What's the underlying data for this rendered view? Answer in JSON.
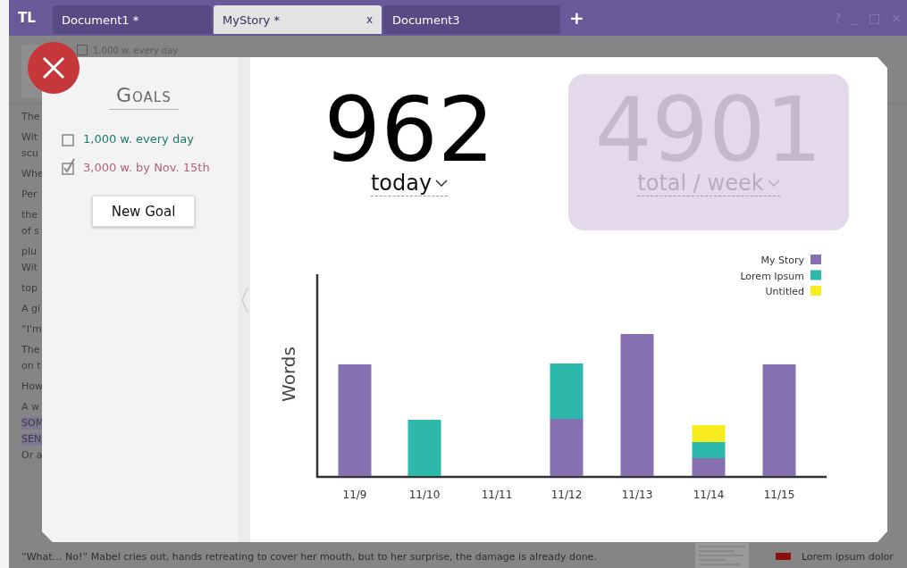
{
  "app": {
    "logo": "TL",
    "tabs": [
      {
        "label": "Document1 *",
        "selected": false
      },
      {
        "label": "MyStory *",
        "selected": true,
        "close": "x"
      },
      {
        "label": "Document3",
        "selected": false
      }
    ],
    "new_tab": "+",
    "window_controls": [
      "?",
      "_",
      "□",
      "×"
    ],
    "toolbar": {
      "goal_check": {
        "label": "1,000 w. every day",
        "checked": false
      }
    }
  },
  "document": {
    "lines": [
      {
        "text": "The",
        "highlighted": false
      },
      {
        "text": "Wit",
        "highlighted": false
      },
      {
        "text": "scu",
        "highlighted": false
      },
      {
        "text": "Whe",
        "highlighted": false
      },
      {
        "text": "Per",
        "highlighted": false
      },
      {
        "text": "the",
        "highlighted": false
      },
      {
        "text": "of s",
        "highlighted": false
      },
      {
        "text": "plu",
        "highlighted": false
      },
      {
        "text": "Wit",
        "highlighted": false
      },
      {
        "text": "top",
        "highlighted": false
      },
      {
        "text": "A gi",
        "highlighted": false
      },
      {
        "text": "“I'm",
        "highlighted": false
      },
      {
        "text": "The",
        "highlighted": false
      },
      {
        "text": "on t",
        "highlighted": false
      },
      {
        "text": "How",
        "highlighted": false
      },
      {
        "text": "A w",
        "highlighted": false
      },
      {
        "text": "SOM",
        "highlighted": true
      },
      {
        "text": "SEN",
        "highlighted": true
      },
      {
        "text": "Or a",
        "highlighted": false
      }
    ],
    "last_line": "“What… No!” Mabel cries out, hands retreating to cover her mouth, but to her surprise, the damage is already done.",
    "side_label": "Lorem ipsum dolor"
  },
  "goals_dialog": {
    "title": "Goals",
    "goals": [
      {
        "label": "1,000 w. every day",
        "checked": false,
        "color": "#1e7a68"
      },
      {
        "label": "3,000 w. by Nov. 15th",
        "checked": true,
        "color": "#b3607e"
      }
    ],
    "new_goal_button": "New Goal",
    "today": {
      "value": "962",
      "label": "today"
    },
    "total": {
      "value": "4901",
      "label": "total / week"
    },
    "chart": {
      "ylabel": "Words",
      "categories": [
        "11/9",
        "11/10",
        "11/11",
        "11/12",
        "11/13",
        "11/14",
        "11/15"
      ],
      "legend": [
        {
          "name": "My Story",
          "color": "#8670b2"
        },
        {
          "name": "Lorem Ipsum",
          "color": "#2cb8aa"
        },
        {
          "name": "Untitled",
          "color": "#f7ec1e"
        }
      ]
    }
  }
}
